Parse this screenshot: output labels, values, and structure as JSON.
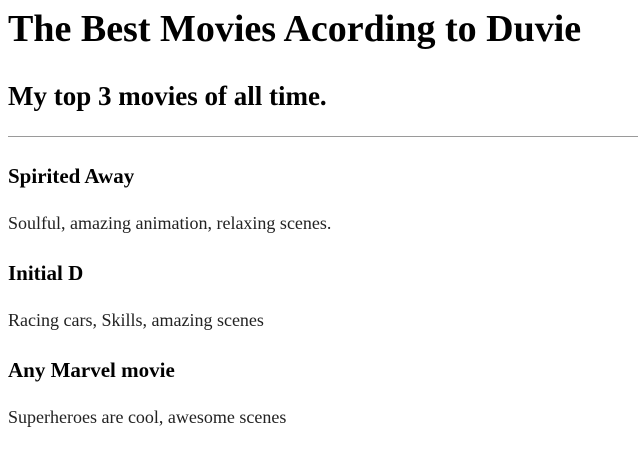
{
  "page": {
    "title": "The Best Movies Acording to Duvie",
    "subtitle": "My top 3 movies of all time."
  },
  "movies": [
    {
      "name": "Spirited Away",
      "description": "Soulful, amazing animation, relaxing scenes."
    },
    {
      "name": "Initial D",
      "description": "Racing cars, Skills, amazing scenes"
    },
    {
      "name": "Any Marvel movie",
      "description": "Superheroes are cool, awesome scenes"
    }
  ]
}
